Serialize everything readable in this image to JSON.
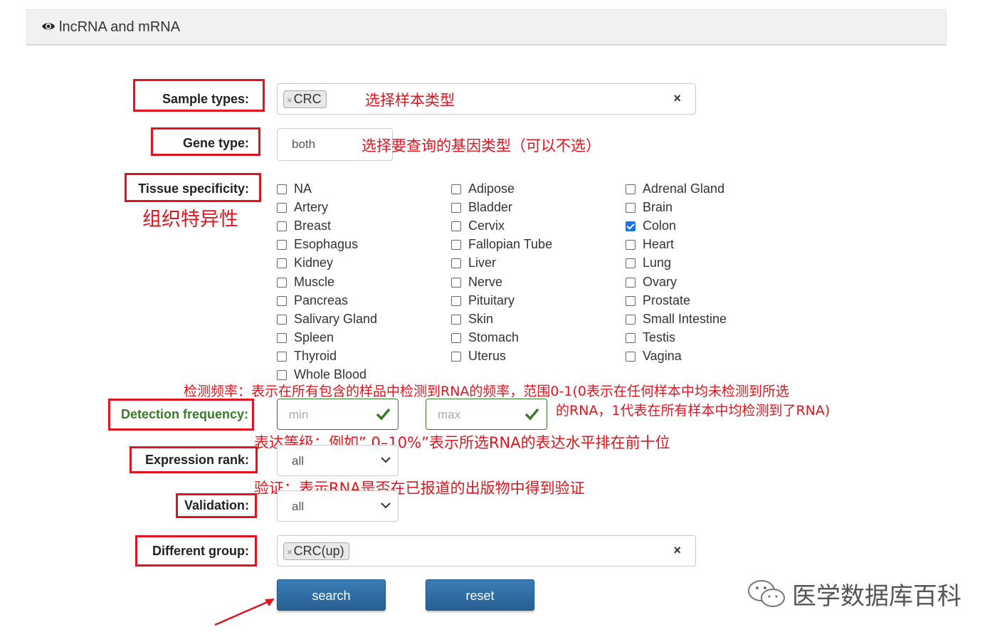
{
  "panel": {
    "title": "lncRNA and mRNA"
  },
  "sample_types": {
    "label": "Sample types:",
    "tag": "CRC",
    "tag_remove": "×",
    "clear": "×",
    "note": "选择样本类型"
  },
  "gene_type": {
    "label": "Gene type:",
    "value": "both",
    "note": "选择要查询的基因类型（可以不选）"
  },
  "tissue": {
    "label": "Tissue specificity:",
    "note": "组织特异性",
    "columns": [
      [
        "NA",
        "Artery",
        "Breast",
        "Esophagus",
        "Kidney",
        "Muscle",
        "Pancreas",
        "Salivary Gland",
        "Spleen",
        "Thyroid",
        "Whole Blood"
      ],
      [
        "Adipose",
        "Bladder",
        "Cervix",
        "Fallopian Tube",
        "Liver",
        "Nerve",
        "Pituitary",
        "Skin",
        "Stomach",
        "Uterus"
      ],
      [
        "Adrenal Gland",
        "Brain",
        "Colon",
        "Heart",
        "Lung",
        "Ovary",
        "Prostate",
        "Small Intestine",
        "Testis",
        "Vagina"
      ]
    ],
    "checked": [
      "Colon"
    ]
  },
  "detection": {
    "label": "Detection frequency:",
    "min_placeholder": "min",
    "max_placeholder": "max",
    "note_line1": "检测频率：表示在所有包含的样品中检测到RNA的频率，范围0-1(0表示在任何样本中均未检测到所选",
    "note_line2": "的RNA，1代表在所有样本中均检测到了RNA)"
  },
  "expression": {
    "label": "Expression rank:",
    "value": "all",
    "note": "表达等级：例如” 0–10%”表示所选RNA的表达水平排在前十位"
  },
  "validation": {
    "label": "Validation:",
    "value": "all",
    "note": "验证：表示RNA是否在已报道的出版物中得到验证"
  },
  "different_group": {
    "label": "Different group:",
    "tag": "CRC(up)",
    "tag_remove": "×",
    "clear": "×"
  },
  "buttons": {
    "search": "search",
    "reset": "reset"
  },
  "watermark": "医学数据库百科",
  "colors": {
    "annotation_red": "#e0141e",
    "button_blue": "#2f6ea6",
    "valid_green": "#3b7a2b",
    "checkbox_checked": "#1a73e8"
  }
}
